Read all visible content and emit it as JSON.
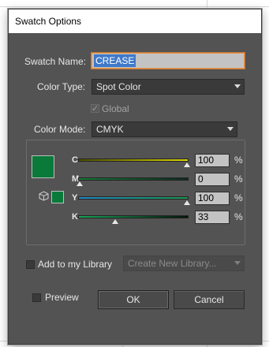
{
  "dialog": {
    "title": "Swatch Options"
  },
  "swatch_name": {
    "label": "Swatch Name:",
    "value": "CREASE"
  },
  "color_type": {
    "label": "Color Type:",
    "selected": "Spot Color"
  },
  "global": {
    "label": "Global",
    "checked": true,
    "enabled": false
  },
  "color_mode": {
    "label": "Color Mode:",
    "selected": "CMYK",
    "swatch_color": "#0a7a3a"
  },
  "sliders": [
    {
      "label": "C",
      "value": "100",
      "unit": "%",
      "fraction": 1.0,
      "gradient": [
        "#4a4f00",
        "#e0d800"
      ]
    },
    {
      "label": "M",
      "value": "0",
      "unit": "%",
      "fraction": 0.0,
      "gradient": [
        "#1a7a3a",
        "#102a20"
      ]
    },
    {
      "label": "Y",
      "value": "100",
      "unit": "%",
      "fraction": 1.0,
      "gradient": [
        "#1f8acb",
        "#1a9a50"
      ]
    },
    {
      "label": "K",
      "value": "33",
      "unit": "%",
      "fraction": 0.33,
      "gradient": [
        "#1aa65a",
        "#04150b"
      ]
    }
  ],
  "library": {
    "label": "Add to my Library",
    "checked": false,
    "dropdown": "Create New Library..."
  },
  "preview": {
    "label": "Preview",
    "checked": false
  },
  "buttons": {
    "ok": "OK",
    "cancel": "Cancel"
  }
}
